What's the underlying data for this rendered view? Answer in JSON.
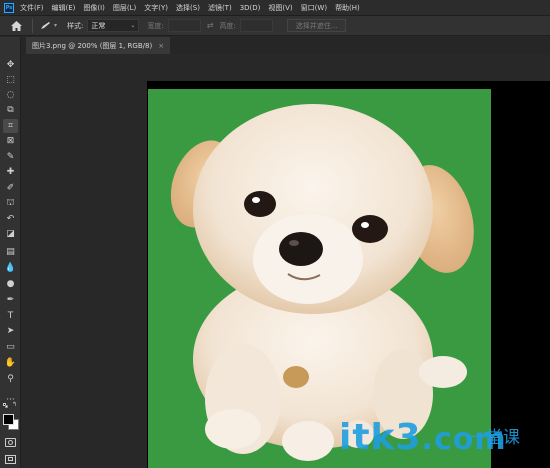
{
  "app": {
    "logo": "Ps"
  },
  "menu": {
    "items": [
      "文件(F)",
      "编辑(E)",
      "图像(I)",
      "图层(L)",
      "文字(Y)",
      "选择(S)",
      "滤镜(T)",
      "3D(D)",
      "视图(V)",
      "窗口(W)",
      "帮助(H)"
    ]
  },
  "options": {
    "style_label": "样式:",
    "style_value": "正常",
    "width_label": "宽度:",
    "height_label": "高度:",
    "swap_icon": "⇄",
    "refine_button": "选择并遮住..."
  },
  "tab": {
    "label": "图片3.png @ 200% (图层 1, RGB/8)",
    "close": "×"
  },
  "tools": [
    {
      "name": "move-tool-icon",
      "glyph": "✥"
    },
    {
      "name": "marquee-tool-icon",
      "glyph": "⬚"
    },
    {
      "name": "lasso-tool-icon",
      "glyph": "◌"
    },
    {
      "name": "object-select-tool-icon",
      "glyph": "⧉"
    },
    {
      "name": "crop-tool-icon",
      "glyph": "⌗"
    },
    {
      "name": "frame-tool-icon",
      "glyph": "⊠"
    },
    {
      "name": "eyedropper-tool-icon",
      "glyph": "✎"
    },
    {
      "name": "healing-brush-tool-icon",
      "glyph": "✚"
    },
    {
      "name": "brush-tool-icon",
      "glyph": "✐"
    },
    {
      "name": "clone-stamp-tool-icon",
      "glyph": "⛫"
    },
    {
      "name": "history-brush-tool-icon",
      "glyph": "↶"
    },
    {
      "name": "eraser-tool-icon",
      "glyph": "◪"
    },
    {
      "name": "gradient-tool-icon",
      "glyph": "▤"
    },
    {
      "name": "blur-tool-icon",
      "glyph": "💧"
    },
    {
      "name": "dodge-tool-icon",
      "glyph": "●"
    },
    {
      "name": "pen-tool-icon",
      "glyph": "✒"
    },
    {
      "name": "type-tool-icon",
      "glyph": "T"
    },
    {
      "name": "path-select-tool-icon",
      "glyph": "➤"
    },
    {
      "name": "rectangle-tool-icon",
      "glyph": "▭"
    },
    {
      "name": "hand-tool-icon",
      "glyph": "✋"
    },
    {
      "name": "zoom-tool-icon",
      "glyph": "⚲"
    },
    {
      "name": "more-tools-icon",
      "glyph": "···"
    }
  ],
  "watermark": {
    "text": "itk3",
    "suffix": ".com",
    "sub": "一堂课"
  },
  "colors": {
    "accent": "#31a8ff",
    "grass": "#3d9e45",
    "watermark": "#1f9ee0"
  }
}
